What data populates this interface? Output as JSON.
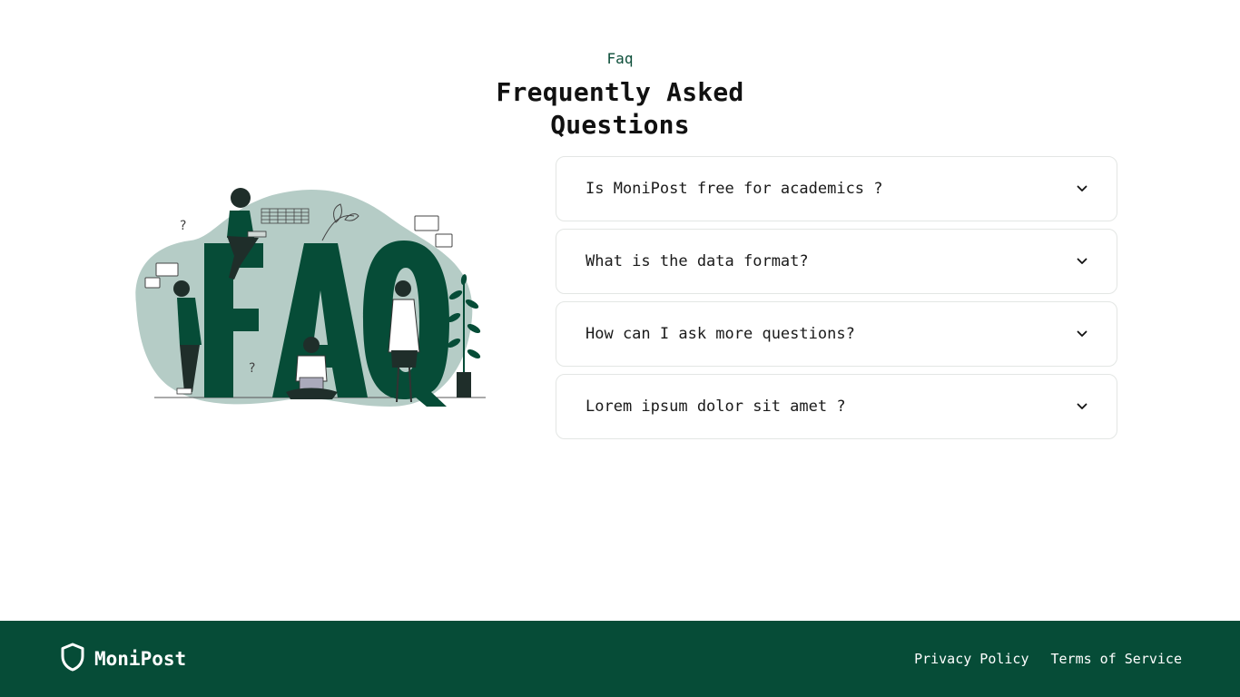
{
  "section": {
    "eyebrow": "Faq",
    "title": "Frequently Asked Questions"
  },
  "faq": {
    "items": [
      {
        "question": "Is MoniPost free for academics ?",
        "icon": "chevron-down-icon"
      },
      {
        "question": "What is the data format?",
        "icon": "chevron-down-icon"
      },
      {
        "question": "How can I ask more questions?",
        "icon": "chevron-down-icon"
      },
      {
        "question": "Lorem ipsum dolor sit amet ?",
        "icon": "chevron-down-icon"
      }
    ]
  },
  "illustration": {
    "letters": "FAQ",
    "icon": "faq-people-illustration"
  },
  "footer": {
    "brand": "MoniPost",
    "brand_icon": "shield-icon",
    "links": [
      "Privacy Policy",
      "Terms of Service"
    ]
  },
  "colors": {
    "primary": "#064c37",
    "blob": "#b5ccc6",
    "text": "#111111",
    "border": "#e3e6e4"
  }
}
